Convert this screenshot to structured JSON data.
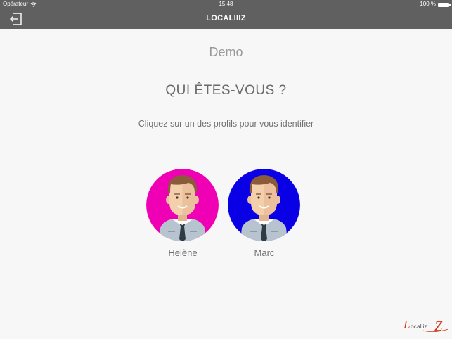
{
  "status_bar": {
    "carrier": "Opérateur",
    "time": "15:48",
    "battery": "100 %",
    "wifi_icon": "wifi-icon",
    "battery_icon": "battery-icon"
  },
  "nav": {
    "title": "LOCALIIIZ",
    "logout_icon": "logout-icon"
  },
  "main": {
    "context": "Demo",
    "heading": "QUI ÊTES-VOUS ?",
    "subheading": "Cliquez sur un des profils pour vous identifier",
    "profiles": [
      {
        "name": "Helène",
        "color": "#f000b4"
      },
      {
        "name": "Marc",
        "color": "#0a00e6"
      }
    ]
  },
  "footer": {
    "logo_text": "Localiiz",
    "logo_accent": "Z"
  },
  "colors": {
    "bar": "#606060",
    "background": "#f7f7f7",
    "logo_red": "#d23a1e"
  }
}
